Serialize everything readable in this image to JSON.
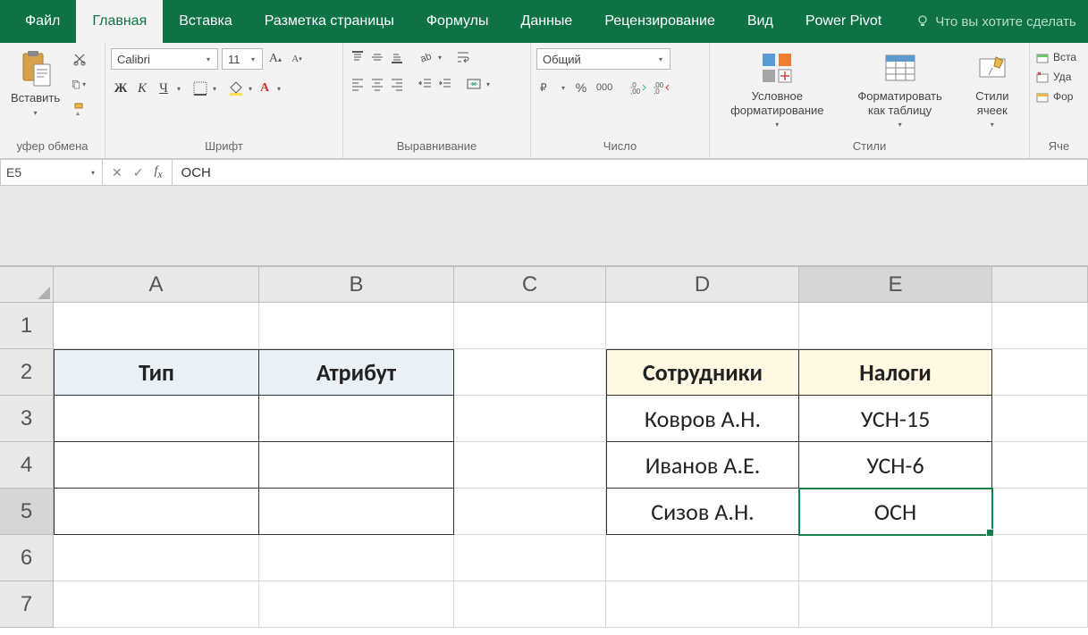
{
  "tabs": {
    "file": "Файл",
    "home": "Главная",
    "insert": "Вставка",
    "layout": "Разметка страницы",
    "formulas": "Формулы",
    "data": "Данные",
    "review": "Рецензирование",
    "view": "Вид",
    "powerpivot": "Power Pivot",
    "tellme": "Что вы хотите сделать"
  },
  "ribbon": {
    "clipboard": {
      "paste": "Вставить",
      "group": "уфер обмена"
    },
    "font": {
      "name": "Calibri",
      "size": "11",
      "bold": "Ж",
      "italic": "К",
      "underline": "Ч",
      "group": "Шрифт"
    },
    "alignment": {
      "group": "Выравнивание"
    },
    "number": {
      "format": "Общий",
      "group": "Число"
    },
    "styles": {
      "cond": "Условное форматирование",
      "table": "Форматировать как таблицу",
      "cell": "Стили ячеек",
      "group": "Стили"
    },
    "cells": {
      "insert": "Вста",
      "delete": "Уда",
      "format": "Фор",
      "group": "Яче"
    }
  },
  "namebox": "E5",
  "formula": "ОСН",
  "columns": [
    "A",
    "B",
    "C",
    "D",
    "E"
  ],
  "sheet": {
    "A2": "Тип",
    "B2": "Атрибут",
    "D2": "Сотрудники",
    "E2": "Налоги",
    "D3": "Ковров А.Н.",
    "E3": "УСН-15",
    "D4": "Иванов А.Е.",
    "E4": "УСН-6",
    "D5": "Сизов А.Н.",
    "E5": "ОСН"
  }
}
